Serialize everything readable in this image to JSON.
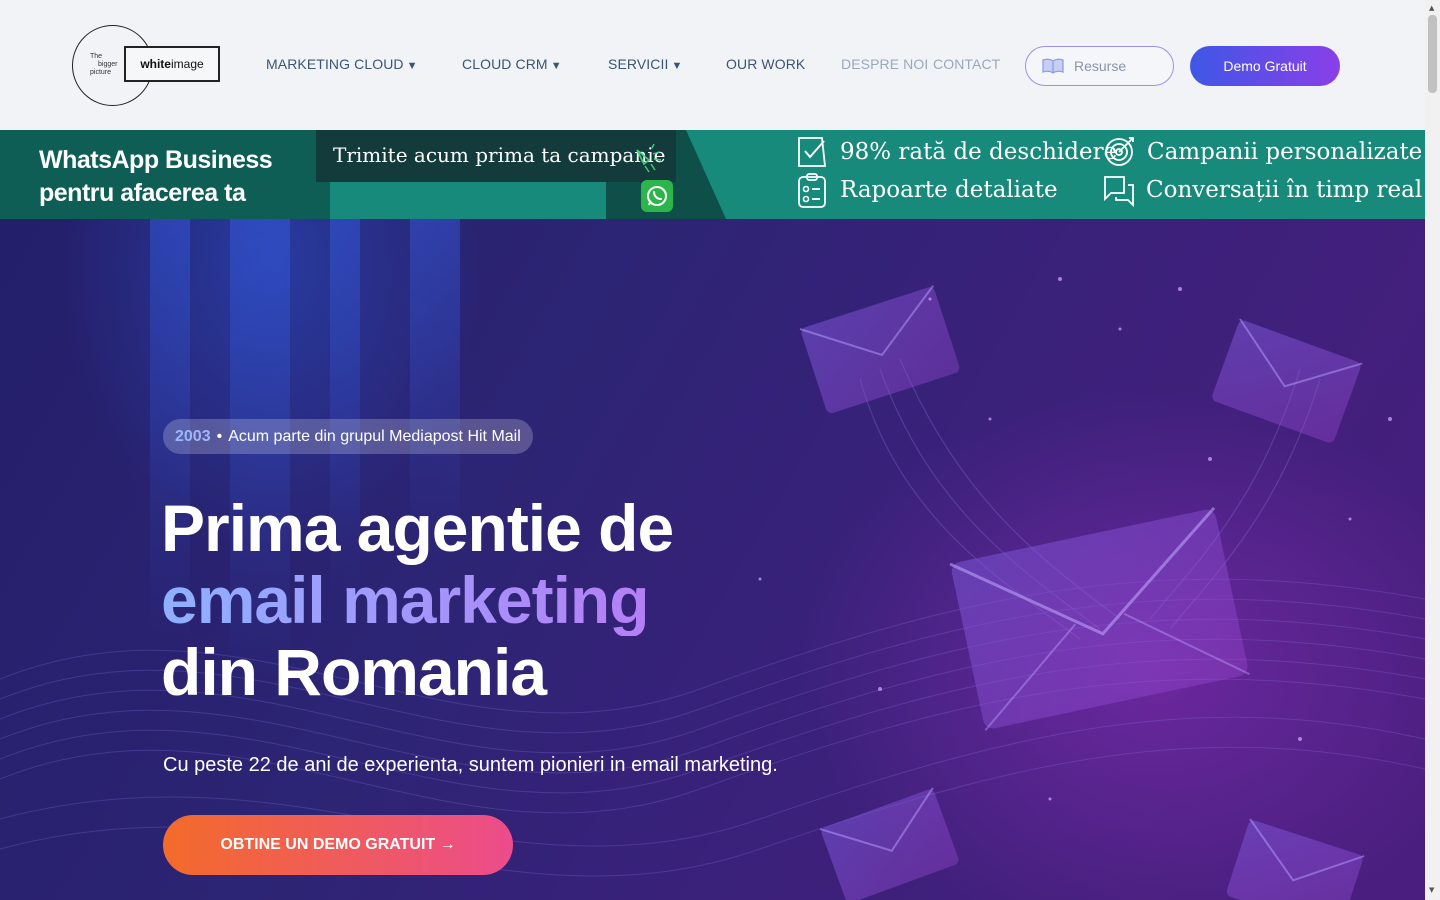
{
  "logo": {
    "small_lines": [
      "The",
      "bigger",
      "picture"
    ],
    "brand_bold": "white",
    "brand_rest": "image"
  },
  "nav": {
    "items": [
      {
        "label": "MARKETING CLOUD",
        "caret": "▼"
      },
      {
        "label": "CLOUD CRM",
        "caret": "▼"
      },
      {
        "label": "SERVICII",
        "caret": "▼"
      },
      {
        "label": "OUR WORK"
      },
      {
        "label": "DESPRE NOI"
      },
      {
        "label": "CONTACT"
      }
    ],
    "resurse_label": "Resurse",
    "demo_label": "Demo Gratuit"
  },
  "banner": {
    "title_line1": "WhatsApp Business",
    "title_line2": "pentru afacerea ta",
    "campaign": "Trimite acum prima ta campanie",
    "features": [
      "98% rată de deschidere",
      "Campanii personalizate",
      "Rapoarte detaliate",
      "Conversații în timp real"
    ]
  },
  "hero": {
    "badge_year": "2003",
    "badge_dot": "•",
    "badge_text": "Acum parte din grupul Mediapost Hit Mail",
    "title_line1": "Prima agentie de",
    "title_line2": "email marketing",
    "title_line3": "din Romania",
    "subtitle": "Cu peste 22 de ani de experienta, suntem pionieri in email marketing.",
    "cta": "OBTINE UN DEMO GRATUIT →"
  },
  "colors": {
    "header_bg": "#f1f3f7",
    "nav_text": "#3c5573",
    "banner_bg": "#178a7b",
    "demo_button_start": "#3f57e6",
    "demo_button_end": "#8a3fe8",
    "cta_start": "#f36b2a",
    "cta_end": "#ec4c8c",
    "hero_bg": "#2c2474"
  },
  "icons": {
    "resurse": "book-open-icon",
    "megaphone": "megaphone-icon",
    "whatsapp": "whatsapp-icon",
    "feature_icons": [
      "check-badge-icon",
      "target-icon",
      "report-list-icon",
      "chat-bubbles-icon"
    ]
  }
}
